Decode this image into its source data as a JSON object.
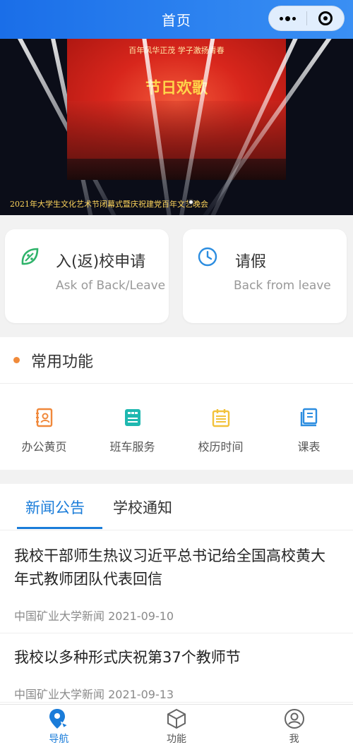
{
  "header": {
    "title": "首页"
  },
  "banner": {
    "stage_top_text": "百年风华正茂  学子激扬青春",
    "stage_main_text": "节日欢歌",
    "caption": "2021年大学生文化艺术节闭幕式暨庆祝建党百年文艺晚会"
  },
  "quick_cards": [
    {
      "title": "入(返)校申请",
      "subtitle": "Ask of Back/Leave",
      "icon": "leaf-icon"
    },
    {
      "title": "请假",
      "subtitle": "Back from leave",
      "icon": "clock-icon"
    }
  ],
  "common": {
    "title": "常用功能",
    "items": [
      {
        "label": "办公黄页",
        "icon": "contacts-book-icon",
        "color": "#f0883a"
      },
      {
        "label": "班车服务",
        "icon": "bus-icon",
        "color": "#1fb8b0"
      },
      {
        "label": "校历时间",
        "icon": "calendar-icon",
        "color": "#f2c23a"
      },
      {
        "label": "课表",
        "icon": "book-icon",
        "color": "#2c8de0"
      }
    ]
  },
  "news": {
    "tabs": [
      "新闻公告",
      "学校通知"
    ],
    "active_tab": 0,
    "articles": [
      {
        "title": "我校干部师生热议习近平总书记给全国高校黄大年式教师团队代表回信",
        "source": "中国矿业大学新闻 2021-09-10"
      },
      {
        "title": "我校以多种形式庆祝第37个教师节",
        "source": "中国矿业大学新闻 2021-09-13"
      }
    ]
  },
  "tabbar": {
    "items": [
      {
        "label": "导航",
        "icon": "navigation-pin-icon",
        "active": true
      },
      {
        "label": "功能",
        "icon": "cube-icon",
        "active": false
      },
      {
        "label": "我",
        "icon": "user-icon",
        "active": false
      }
    ]
  },
  "colors": {
    "accent": "#1a7cd9",
    "header": "#1a6ee8"
  }
}
